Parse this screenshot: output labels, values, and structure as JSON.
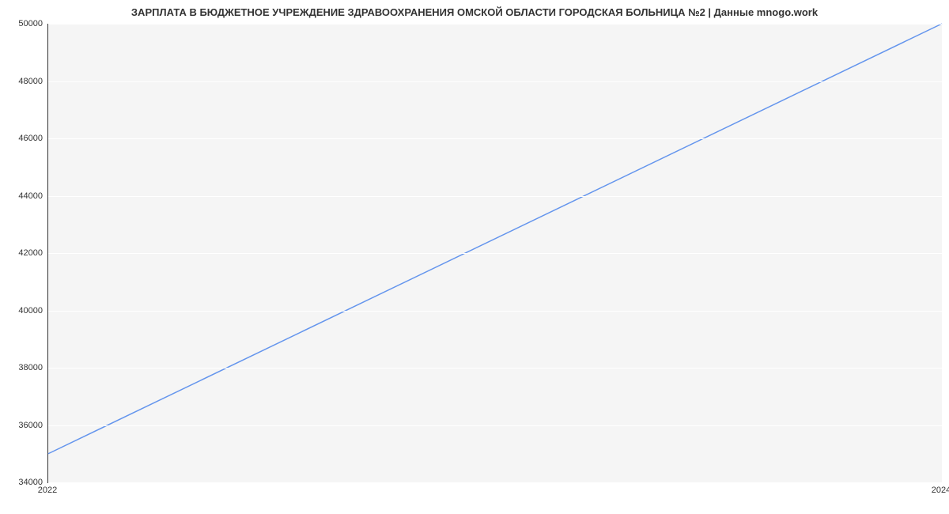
{
  "chart_data": {
    "type": "line",
    "title": "ЗАРПЛАТА В БЮДЖЕТНОЕ УЧРЕЖДЕНИЕ ЗДРАВООХРАНЕНИЯ ОМСКОЙ ОБЛАСТИ ГОРОДСКАЯ БОЛЬНИЦА №2 | Данные mnogo.work",
    "x": [
      2022,
      2024
    ],
    "values": [
      35000,
      50000
    ],
    "xlabel": "",
    "ylabel": "",
    "xlim": [
      2022,
      2024
    ],
    "ylim": [
      34000,
      50000
    ],
    "y_ticks": [
      34000,
      36000,
      38000,
      40000,
      42000,
      44000,
      46000,
      48000,
      50000
    ],
    "x_ticks": [
      2022,
      2024
    ],
    "line_color": "#6495ED"
  }
}
